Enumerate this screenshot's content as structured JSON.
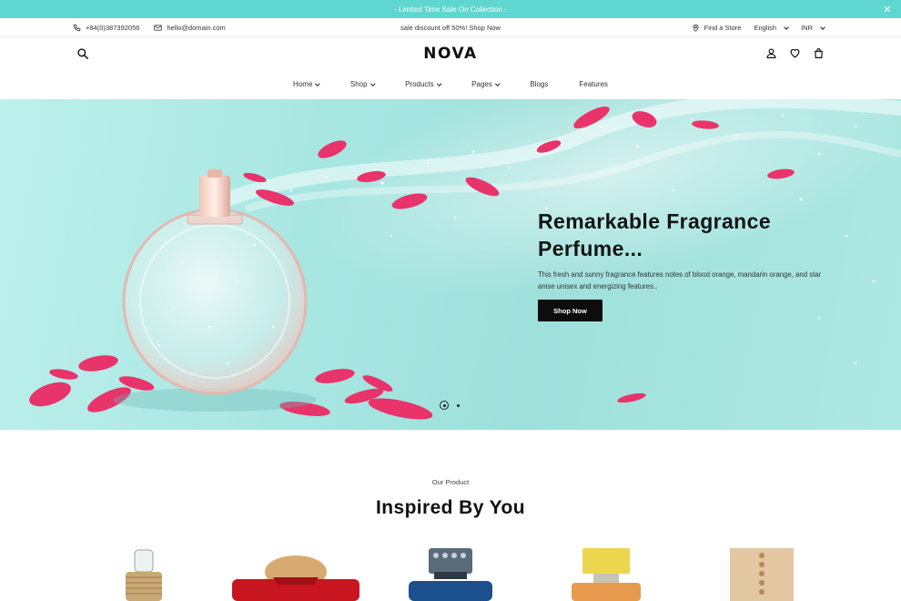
{
  "announcement": {
    "text": "- Limited Time Sale On Collection -",
    "close_icon": "close-icon"
  },
  "topbar": {
    "phone": "+84(0)387392056",
    "email": "hello@domain.com",
    "promo": "sale discount off 50%! Shop Now",
    "find_store": "Find a Store",
    "language": "English",
    "currency": "INR"
  },
  "header": {
    "logo": "NOVA",
    "icons": [
      "search-icon",
      "user-icon",
      "heart-icon",
      "cart-icon"
    ]
  },
  "nav": {
    "items": [
      {
        "label": "Home",
        "has_dropdown": true
      },
      {
        "label": "Shop",
        "has_dropdown": true
      },
      {
        "label": "Products",
        "has_dropdown": true
      },
      {
        "label": "Pages",
        "has_dropdown": true
      },
      {
        "label": "Blogs",
        "has_dropdown": false
      },
      {
        "label": "Features",
        "has_dropdown": false
      }
    ]
  },
  "hero": {
    "title_line1": "Remarkable Fragrance",
    "title_line2": "Perfume...",
    "description": "This fresh and sunny fragrance features notes of blood orange, mandarin orange, and star anise unisex and energizing features..",
    "cta": "Shop Now",
    "slides": 2,
    "active_slide": 1
  },
  "products": {
    "subtitle": "Our Product",
    "title": "Inspired By You"
  },
  "colors": {
    "announcement_bg": "#5fd6cf",
    "hero_bg": "#a8e6e2",
    "petal": "#e8336b",
    "button_bg": "#0d0d0d"
  }
}
